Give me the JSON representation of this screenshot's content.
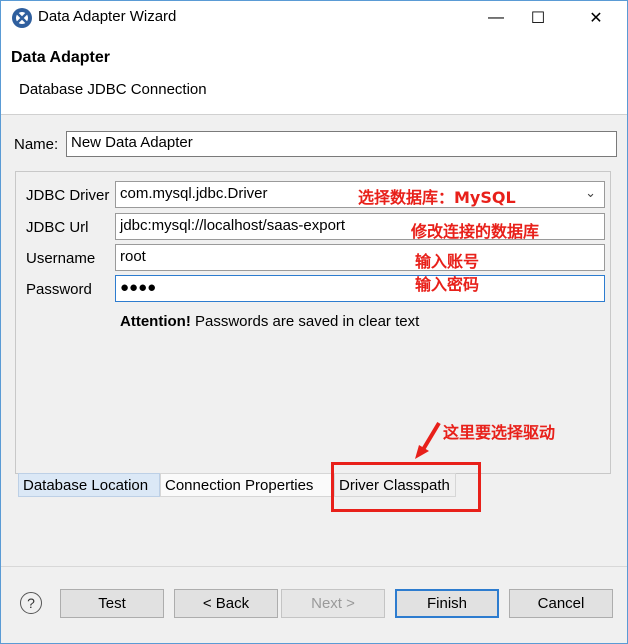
{
  "window": {
    "title": "Data Adapter Wizard",
    "minimize": "—",
    "maximize": "☐",
    "close": "✕"
  },
  "banner": {
    "title": "Data Adapter",
    "description": "Database JDBC Connection"
  },
  "name_field": {
    "label": "Name:",
    "value": "New Data Adapter"
  },
  "connection": {
    "driver_label": "JDBC Driver",
    "driver_value": "com.mysql.jdbc.Driver",
    "url_label": "JDBC Url",
    "url_value": "jdbc:mysql://localhost/saas-export",
    "username_label": "Username",
    "username_value": "root",
    "password_label": "Password",
    "password_value": "●●●●",
    "attention_bold": "Attention!",
    "attention_text": " Passwords are saved in clear text"
  },
  "annotations": {
    "driver": "选择数据库：MySQL",
    "url": "修改连接的数据库",
    "username": "输入账号",
    "password": "输入密码",
    "driver_classpath": "这里要选择驱动"
  },
  "tabs": [
    {
      "label": "Database Location",
      "selected": true
    },
    {
      "label": "Connection Properties",
      "selected": false
    },
    {
      "label": "Driver Classpath",
      "selected": false
    }
  ],
  "buttons": {
    "help": "?",
    "test": "Test",
    "back": "< Back",
    "next": "Next >",
    "finish": "Finish",
    "cancel": "Cancel"
  },
  "colors": {
    "annotation_red": "#e8201a",
    "focus_blue": "#2d7ccf",
    "selected_tab": "#dbe8f6"
  }
}
